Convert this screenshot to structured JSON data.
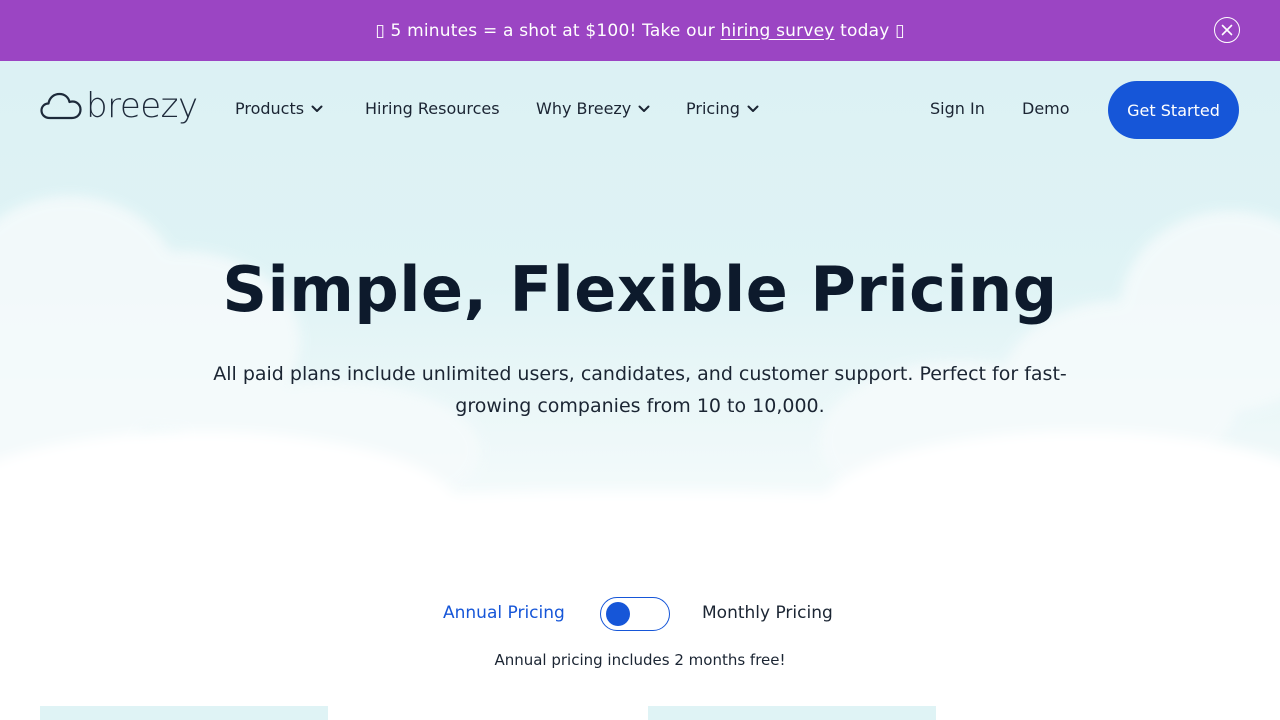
{
  "banner": {
    "prefix": "▯ 5 minutes = a shot at $100! Take our ",
    "link": "hiring survey",
    "suffix": " today ▯",
    "close_icon": "close-circle-icon"
  },
  "nav": {
    "logo_text": "breezy",
    "items": [
      {
        "label": "Products",
        "dropdown": true
      },
      {
        "label": "Hiring Resources",
        "dropdown": false
      },
      {
        "label": "Why Breezy",
        "dropdown": true
      },
      {
        "label": "Pricing",
        "dropdown": true
      }
    ],
    "sign_in": "Sign In",
    "demo": "Demo",
    "cta": "Get Started"
  },
  "hero": {
    "title": "Simple, Flexible Pricing",
    "subtitle": "All paid plans include unlimited users, candidates, and customer support. Perfect for fast-growing companies from 10 to 10,000."
  },
  "pricing_toggle": {
    "annual_label": "Annual Pricing",
    "monthly_label": "Monthly Pricing",
    "selected": "Annual Pricing",
    "note": "Annual pricing includes 2 months free!"
  },
  "colors": {
    "banner": "#9b45c3",
    "accent": "#1656d8",
    "hero_bg": "#dcf1f4",
    "text": "#0d1a2c"
  }
}
